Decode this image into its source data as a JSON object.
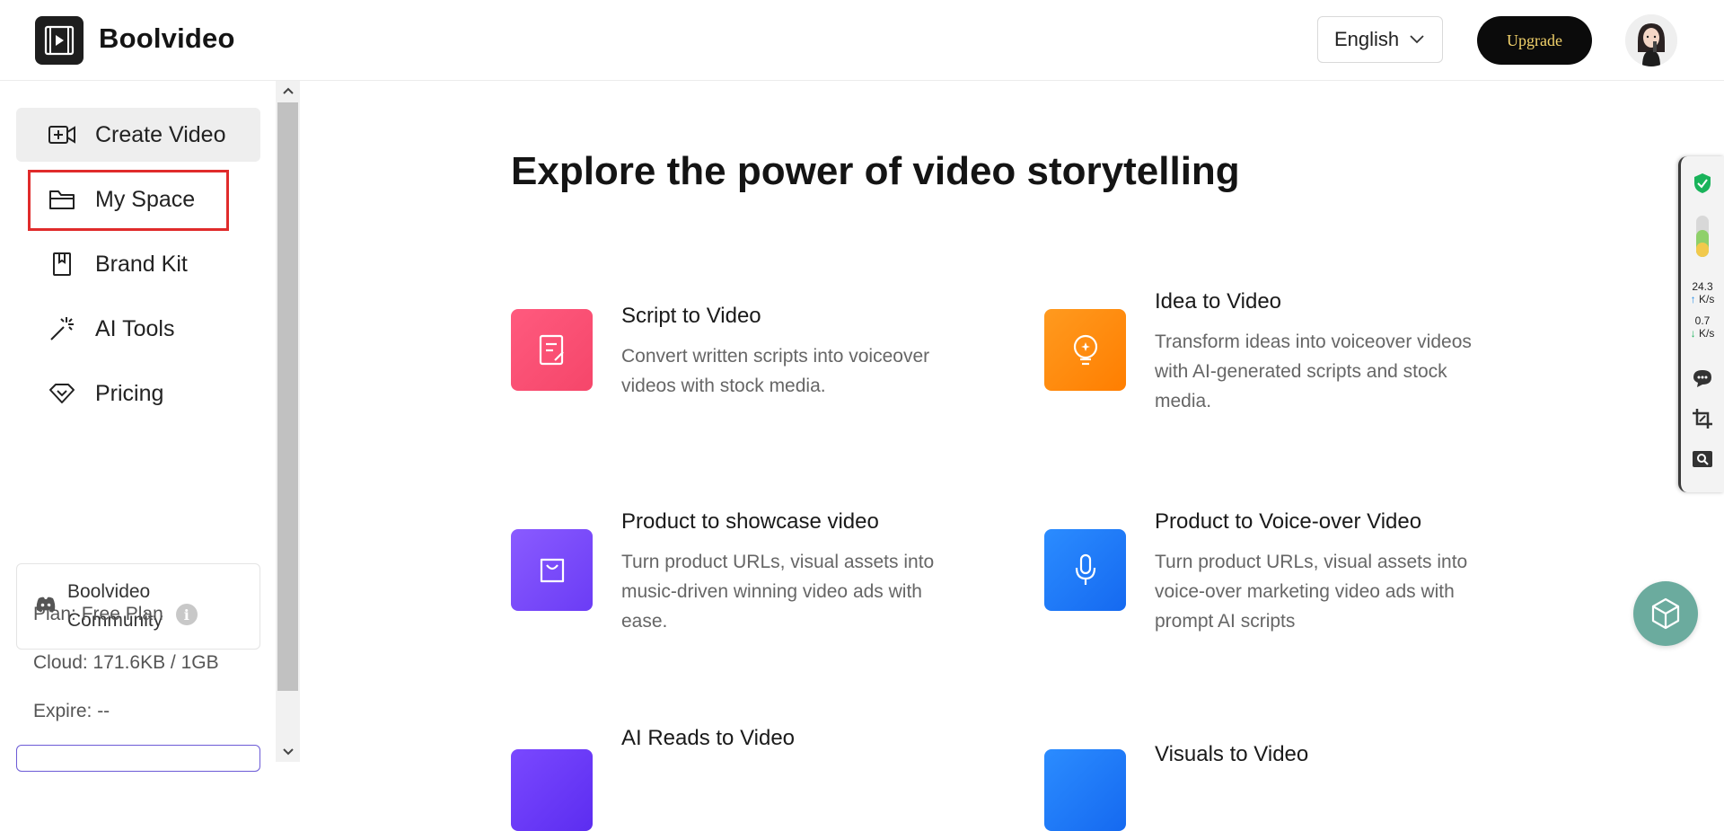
{
  "header": {
    "brand": "Boolvideo",
    "language": "English",
    "upgrade_label": "Upgrade"
  },
  "sidebar": {
    "items": [
      {
        "label": "Create Video",
        "icon": "video-add-icon"
      },
      {
        "label": "My Space",
        "icon": "folder-icon"
      },
      {
        "label": "Brand Kit",
        "icon": "bookmark-icon"
      },
      {
        "label": "AI Tools",
        "icon": "magic-wand-icon"
      },
      {
        "label": "Pricing",
        "icon": "diamond-icon"
      }
    ],
    "community_label": "Boolvideo Community",
    "plan": "Plan: Free Plan",
    "cloud": "Cloud: 171.6KB / 1GB",
    "expire": "Expire: --"
  },
  "main": {
    "title": "Explore the power of video storytelling",
    "cards": [
      {
        "title": "Script to Video",
        "desc": "Convert written scripts into voiceover videos with stock media.",
        "color": "#f5466a",
        "icon": "script-icon"
      },
      {
        "title": "Idea to Video",
        "desc": "Transform ideas into voiceover videos with AI-generated scripts and stock media.",
        "color": "#ff8a00",
        "icon": "lightbulb-icon"
      },
      {
        "title": "Product to showcase video",
        "desc": "Turn product URLs, visual assets into music-driven winning video ads with ease.",
        "color": "#7b4dff",
        "icon": "shopping-bag-icon"
      },
      {
        "title": "Product to Voice-over Video",
        "desc": "Turn product URLs, visual assets into voice-over marketing video ads with prompt AI scripts",
        "color": "#1e7cff",
        "icon": "microphone-icon"
      },
      {
        "title": "AI Reads to Video",
        "desc": "",
        "color": "#6a3cff",
        "icon": ""
      },
      {
        "title": "Visuals to Video",
        "desc": "",
        "color": "#1e7cff",
        "icon": ""
      }
    ]
  },
  "widget": {
    "up_speed": "24.3",
    "up_unit": "K/s",
    "down_speed": "0.7",
    "down_unit": "K/s"
  }
}
